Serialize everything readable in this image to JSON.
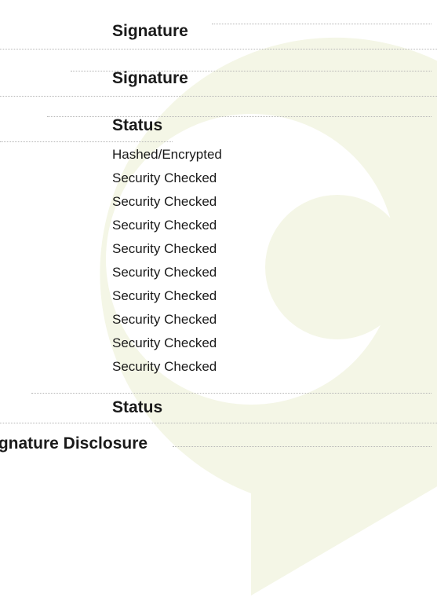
{
  "sections": {
    "signature_1": "Signature",
    "signature_2": "Signature",
    "status_1": "Status",
    "status_2": "Status",
    "signature_disclosure": "Signature Disclosure"
  },
  "status_items": [
    "Hashed/Encrypted",
    "Security Checked",
    "Security Checked",
    "Security Checked",
    "Security Checked",
    "Security Checked",
    "Security Checked",
    "Security Checked",
    "Security Checked",
    "Security Checked"
  ],
  "colors": {
    "watermark": "#f4f6e6",
    "text": "#1a1a1a"
  },
  "watermark_icon": "speech-bubble-logo"
}
